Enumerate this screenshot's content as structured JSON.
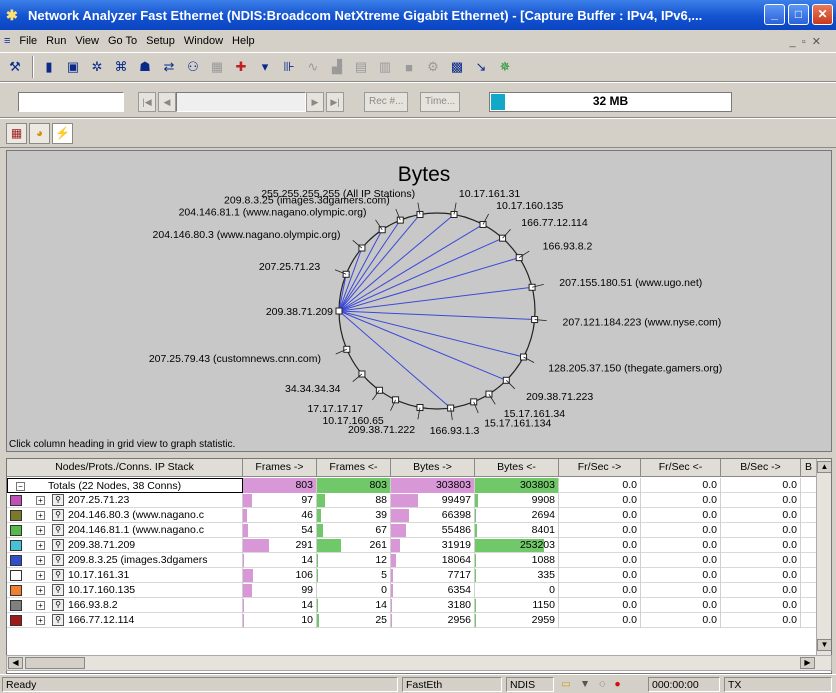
{
  "window": {
    "title": "Network Analyzer Fast Ethernet (NDIS:Broadcom NetXtreme Gigabit Ethernet) - [Capture Buffer : IPv4, IPv6,..."
  },
  "menu": [
    "File",
    "Run",
    "View",
    "Go To",
    "Setup",
    "Window",
    "Help"
  ],
  "toolbar2": {
    "rec_label": "Rec #...",
    "time_label": "Time...",
    "buffer_label": "32 MB",
    "buffer_fill": 0.06
  },
  "graph": {
    "title": "Bytes",
    "hint": "Click column heading in grid view to graph statistic.",
    "center_node": "209.38.71.209",
    "nodes": [
      {
        "label": "255.255.255.255 (All IP Stations)",
        "angle": -100,
        "linked": true
      },
      {
        "label": "10.17.161.31",
        "angle": -80,
        "linked": true
      },
      {
        "label": "10.17.160.135",
        "angle": -62,
        "linked": true
      },
      {
        "label": "166.77.12.114",
        "angle": -48,
        "linked": true
      },
      {
        "label": "166.93.8.2",
        "angle": -33,
        "linked": true
      },
      {
        "label": "207.155.180.51 (www.ugo.net)",
        "angle": -14,
        "linked": true
      },
      {
        "label": "207.121.184.223 (www.nyse.com)",
        "angle": 5,
        "linked": true
      },
      {
        "label": "128.205.37.150 (thegate.gamers.org)",
        "angle": 28,
        "linked": true
      },
      {
        "label": "209.38.71.223",
        "angle": 45,
        "linked": true
      },
      {
        "label": "15.17.161.34",
        "angle": 58,
        "linked": false
      },
      {
        "label": "15.17.161.134",
        "angle": 68,
        "linked": false
      },
      {
        "label": "166.93.1.3",
        "angle": 82,
        "linked": true
      },
      {
        "label": "209.38.71.222",
        "angle": 100,
        "linked": false
      },
      {
        "label": "10.17.160.65",
        "angle": 115,
        "linked": false
      },
      {
        "label": "17.17.17.17",
        "angle": 126,
        "linked": false
      },
      {
        "label": "34.34.34.34",
        "angle": 140,
        "linked": false
      },
      {
        "label": "207.25.79.43 (customnews.cnn.com)",
        "angle": 157,
        "linked": false
      },
      {
        "label": "207.25.71.23",
        "angle": -158,
        "linked": true
      },
      {
        "label": "204.146.80.3 (www.nagano.olympic.org)",
        "angle": -140,
        "linked": true
      },
      {
        "label": "204.146.81.1 (www.nagano.olympic.org)",
        "angle": -124,
        "linked": true
      },
      {
        "label": "209.8.3.25 (images.3dgamers.com)",
        "angle": -112,
        "linked": true
      }
    ]
  },
  "grid": {
    "columns": [
      "Nodes/Prots./Conns. IP Stack",
      "Frames ->",
      "Frames <-",
      "Bytes ->",
      "Bytes <-",
      "Fr/Sec ->",
      "Fr/Sec <-",
      "B/Sec ->",
      "B"
    ],
    "totals": {
      "name": "Totals (22 Nodes, 38 Conns)",
      "frames_out": "803",
      "frames_in": "803",
      "bytes_out": "303803",
      "bytes_in": "303803",
      "frs_out": "0.0",
      "frs_in": "0.0",
      "bs_out": "0.0"
    },
    "rows": [
      {
        "name": "207.25.71.23",
        "color": "#c050b8",
        "frames_out": "97",
        "frames_in": "88",
        "bytes_out": "99497",
        "bytes_in": "9908",
        "frs_out": "0.0",
        "frs_in": "0.0",
        "bs_out": "0.0"
      },
      {
        "name": "204.146.80.3 (www.nagano.c",
        "color": "#7a7a2a",
        "frames_out": "46",
        "frames_in": "39",
        "bytes_out": "66398",
        "bytes_in": "2694",
        "frs_out": "0.0",
        "frs_in": "0.0",
        "bs_out": "0.0"
      },
      {
        "name": "204.146.81.1 (www.nagano.c",
        "color": "#58b848",
        "frames_out": "54",
        "frames_in": "67",
        "bytes_out": "55486",
        "bytes_in": "8401",
        "frs_out": "0.0",
        "frs_in": "0.0",
        "bs_out": "0.0"
      },
      {
        "name": "209.38.71.209",
        "color": "#48c0d8",
        "frames_out": "291",
        "frames_in": "261",
        "bytes_out": "31919",
        "bytes_in": "253203",
        "frs_out": "0.0",
        "frs_in": "0.0",
        "bs_out": "0.0"
      },
      {
        "name": "209.8.3.25 (images.3dgamers",
        "color": "#3050c8",
        "frames_out": "14",
        "frames_in": "12",
        "bytes_out": "18064",
        "bytes_in": "1088",
        "frs_out": "0.0",
        "frs_in": "0.0",
        "bs_out": "0.0"
      },
      {
        "name": "10.17.161.31",
        "color": "#ffffff",
        "frames_out": "106",
        "frames_in": "5",
        "bytes_out": "7717",
        "bytes_in": "335",
        "frs_out": "0.0",
        "frs_in": "0.0",
        "bs_out": "0.0"
      },
      {
        "name": "10.17.160.135",
        "color": "#f08030",
        "frames_out": "99",
        "frames_in": "0",
        "bytes_out": "6354",
        "bytes_in": "0",
        "frs_out": "0.0",
        "frs_in": "0.0",
        "bs_out": "0.0"
      },
      {
        "name": "166.93.8.2",
        "color": "#808080",
        "frames_out": "14",
        "frames_in": "14",
        "bytes_out": "3180",
        "bytes_in": "1150",
        "frs_out": "0.0",
        "frs_in": "0.0",
        "bs_out": "0.0"
      },
      {
        "name": "166.77.12.114",
        "color": "#a01818",
        "frames_out": "10",
        "frames_in": "25",
        "bytes_out": "2956",
        "bytes_in": "2959",
        "frs_out": "0.0",
        "frs_in": "0.0",
        "bs_out": "0.0"
      }
    ]
  },
  "status": {
    "ready": "Ready",
    "adapter": "FastEth",
    "driver": "NDIS",
    "timer": "000:00:00",
    "tx": "TX"
  },
  "colors": {
    "frames_out_bar": "#d898d8",
    "frames_in_bar": "#70c868",
    "bytes_out_bar": "#d898d8",
    "bytes_in_bar": "#70c868",
    "link": "#3a48d8"
  }
}
